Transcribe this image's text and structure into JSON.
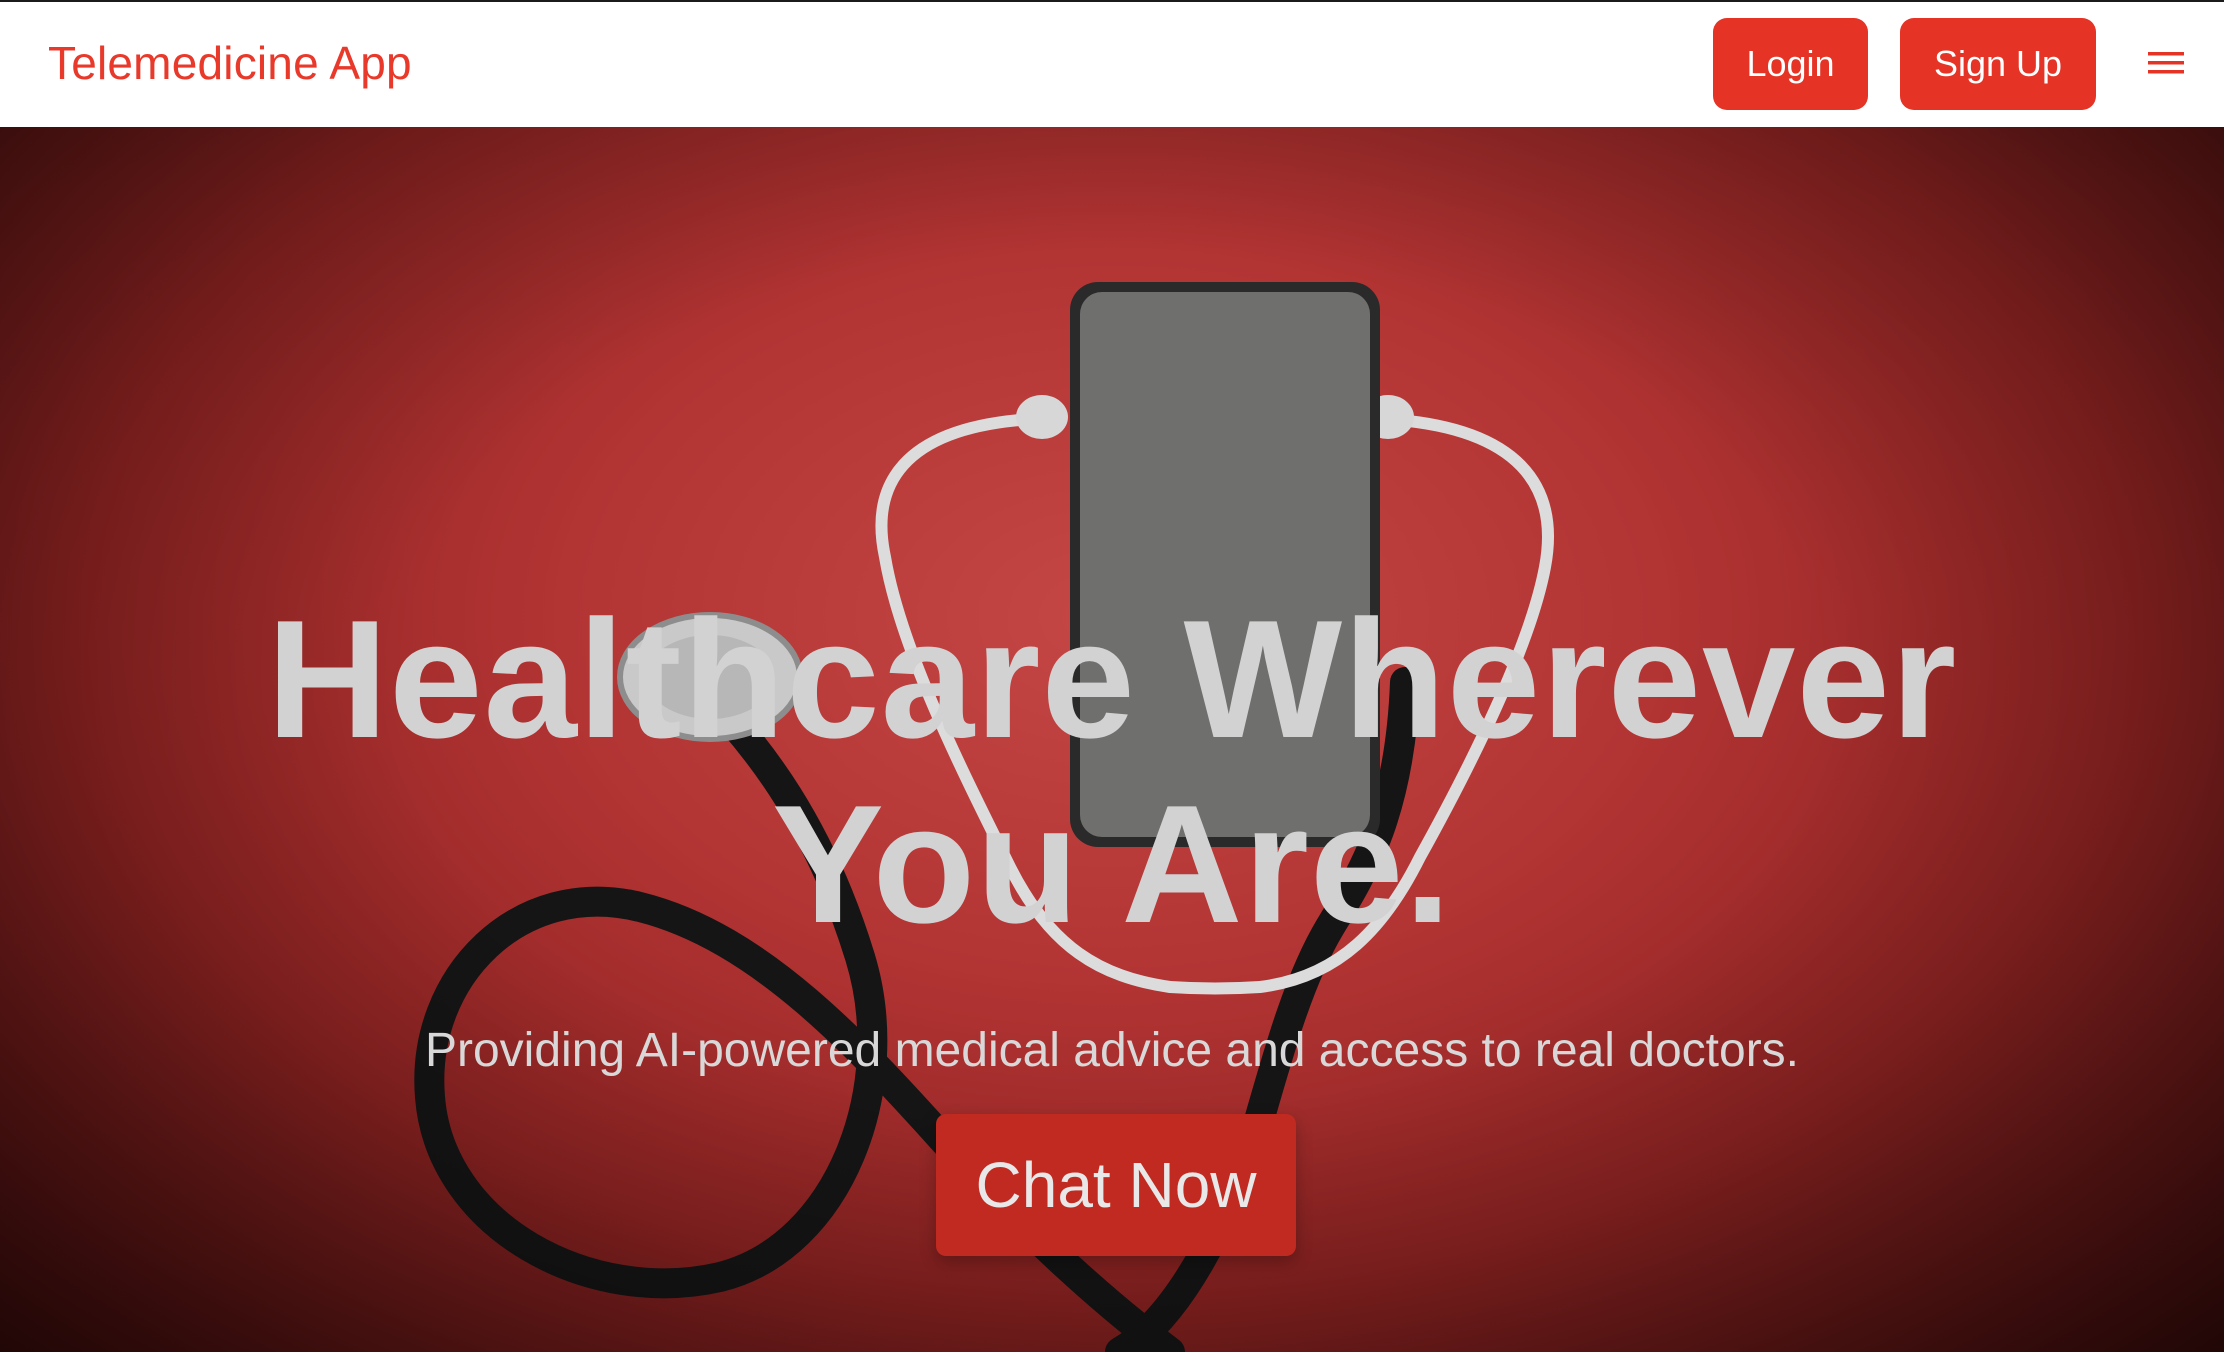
{
  "navbar": {
    "brand": "Telemedicine App",
    "login_label": "Login",
    "signup_label": "Sign Up",
    "menu_icon": "hamburger-menu-icon"
  },
  "hero": {
    "headline": "Healthcare Wherever You Are.",
    "subtitle": "Providing AI-powered medical advice and access to real doctors.",
    "cta_label": "Chat Now",
    "image": "stethoscope-and-phone-on-red-background"
  },
  "colors": {
    "brand": "#e8392b",
    "button": "#e53326",
    "cta": "#c02a21",
    "hero_background": "#b23433",
    "headline_text": "#d2d2d2"
  }
}
